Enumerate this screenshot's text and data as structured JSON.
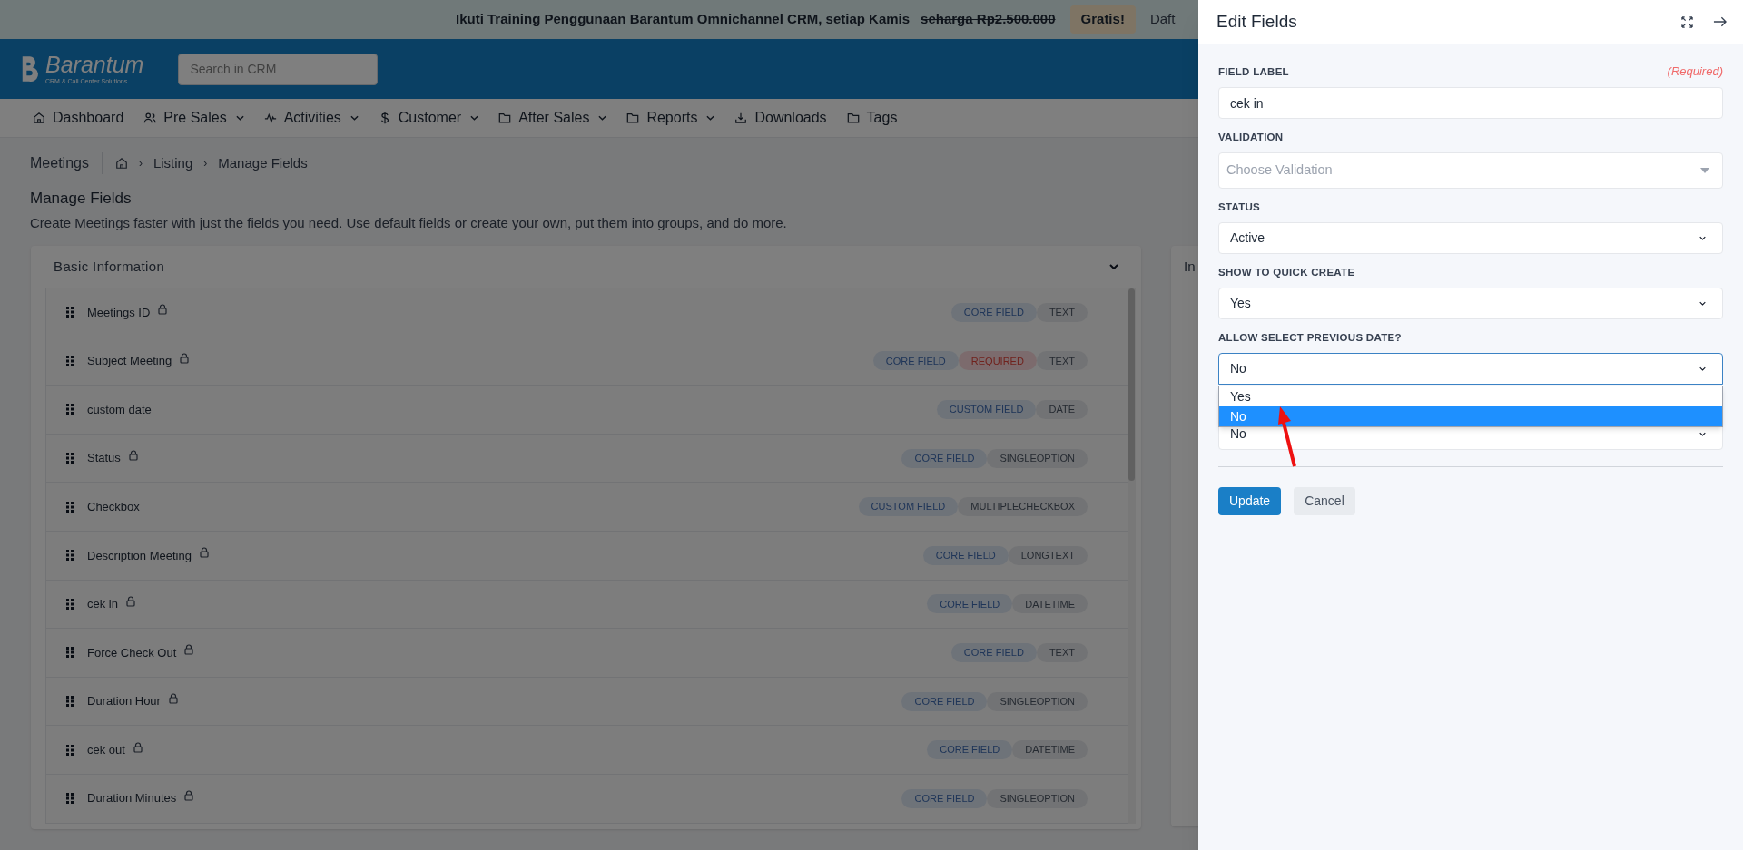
{
  "banner": {
    "text": "Ikuti Training Penggunaan Barantum Omnichannel CRM, setiap Kamis",
    "old_price": "seharga Rp2.500.000",
    "badge": "Gratis!",
    "link": "Daft"
  },
  "header": {
    "logo_name": "Barantum",
    "logo_tagline": "CRM & Call Center Solutions",
    "search_placeholder": "Search in CRM"
  },
  "nav": [
    {
      "label": "Dashboard",
      "dropdown": false
    },
    {
      "label": "Pre Sales",
      "dropdown": true
    },
    {
      "label": "Activities",
      "dropdown": true
    },
    {
      "label": "Customer",
      "dropdown": true
    },
    {
      "label": "After Sales",
      "dropdown": true
    },
    {
      "label": "Reports",
      "dropdown": true
    },
    {
      "label": "Downloads",
      "dropdown": false
    },
    {
      "label": "Tags",
      "dropdown": false
    }
  ],
  "breadcrumb": {
    "module": "Meetings",
    "separator": "›",
    "items": [
      "Listing",
      "Manage Fields"
    ]
  },
  "page": {
    "title": "Manage Fields",
    "description": "Create Meetings faster with just the fields you need. Use default fields or create your own, put them into groups, and do more."
  },
  "card": {
    "title": "Basic Information",
    "expanded": true,
    "rows": [
      {
        "name": "Meetings ID",
        "locked": true,
        "badges": [
          {
            "kind": "core",
            "label": "CORE FIELD"
          },
          {
            "kind": "type",
            "label": "TEXT"
          }
        ]
      },
      {
        "name": "Subject Meeting",
        "locked": true,
        "badges": [
          {
            "kind": "core",
            "label": "CORE FIELD"
          },
          {
            "kind": "required",
            "label": "REQUIRED"
          },
          {
            "kind": "type",
            "label": "TEXT"
          }
        ]
      },
      {
        "name": "custom date",
        "locked": false,
        "badges": [
          {
            "kind": "custom",
            "label": "CUSTOM FIELD"
          },
          {
            "kind": "type",
            "label": "DATE"
          }
        ]
      },
      {
        "name": "Status",
        "locked": true,
        "badges": [
          {
            "kind": "core",
            "label": "CORE FIELD"
          },
          {
            "kind": "type",
            "label": "SINGLEOPTION"
          }
        ]
      },
      {
        "name": "Checkbox",
        "locked": false,
        "badges": [
          {
            "kind": "custom",
            "label": "CUSTOM FIELD"
          },
          {
            "kind": "type",
            "label": "MULTIPLECHECKBOX"
          }
        ]
      },
      {
        "name": "Description Meeting",
        "locked": true,
        "badges": [
          {
            "kind": "core",
            "label": "CORE FIELD"
          },
          {
            "kind": "type",
            "label": "LONGTEXT"
          }
        ]
      },
      {
        "name": "cek in",
        "locked": true,
        "badges": [
          {
            "kind": "core",
            "label": "CORE FIELD"
          },
          {
            "kind": "type",
            "label": "DATETIME"
          }
        ]
      },
      {
        "name": "Force Check Out",
        "locked": true,
        "badges": [
          {
            "kind": "core",
            "label": "CORE FIELD"
          },
          {
            "kind": "type",
            "label": "TEXT"
          }
        ]
      },
      {
        "name": "Duration Hour",
        "locked": true,
        "badges": [
          {
            "kind": "core",
            "label": "CORE FIELD"
          },
          {
            "kind": "type",
            "label": "SINGLEOPTION"
          }
        ]
      },
      {
        "name": "cek out",
        "locked": true,
        "badges": [
          {
            "kind": "core",
            "label": "CORE FIELD"
          },
          {
            "kind": "type",
            "label": "DATETIME"
          }
        ]
      },
      {
        "name": "Duration Minutes",
        "locked": true,
        "badges": [
          {
            "kind": "core",
            "label": "CORE FIELD"
          },
          {
            "kind": "type",
            "label": "SINGLEOPTION"
          }
        ]
      }
    ]
  },
  "side_card": {
    "title": "In"
  },
  "panel": {
    "title": "Edit Fields",
    "fields": [
      {
        "kind": "text",
        "label": "FIELD LABEL",
        "note": "(Required)",
        "value": "cek in"
      },
      {
        "kind": "combobox",
        "label": "VALIDATION",
        "placeholder": "Choose Validation"
      },
      {
        "kind": "select",
        "label": "STATUS",
        "value": "Active",
        "focused": false,
        "expanded": false
      },
      {
        "kind": "select",
        "label": "SHOW TO QUICK CREATE",
        "value": "Yes",
        "focused": false,
        "expanded": false
      },
      {
        "kind": "select",
        "label": "ALLOW SELECT PREVIOUS DATE?",
        "value": "No",
        "focused": true,
        "expanded": true,
        "options": [
          {
            "label": "Yes",
            "selected": false
          },
          {
            "label": "No",
            "selected": true
          }
        ]
      },
      {
        "kind": "select",
        "value": "No",
        "focused": false,
        "expanded": false
      }
    ],
    "buttons": [
      {
        "kind": "primary",
        "label": "Update"
      },
      {
        "kind": "secondary",
        "label": "Cancel"
      }
    ]
  }
}
